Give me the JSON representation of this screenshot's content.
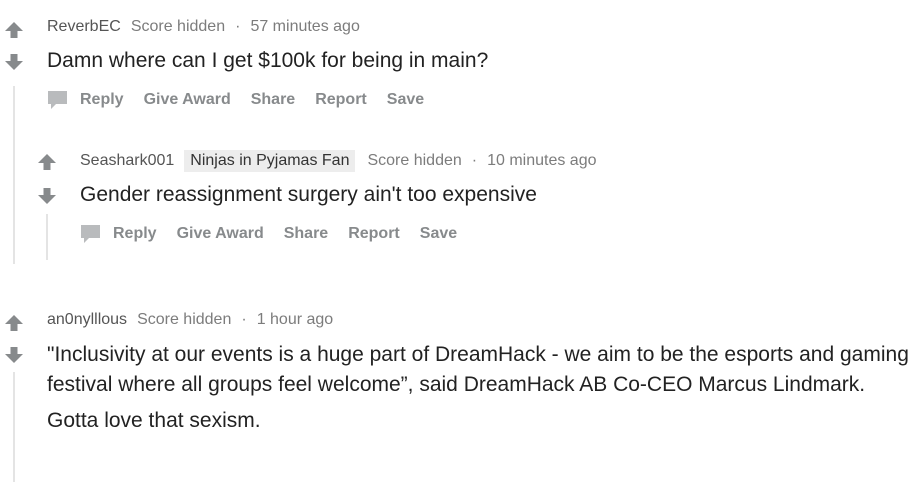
{
  "comments": [
    {
      "author": "ReverbEC",
      "score": "Score hidden",
      "time": "57 minutes ago",
      "text": [
        "Damn where can I get $100k for being in main?"
      ],
      "actions": {
        "reply": "Reply",
        "award": "Give Award",
        "share": "Share",
        "report": "Report",
        "save": "Save"
      }
    },
    {
      "author": "Seashark001",
      "flair": "Ninjas in Pyjamas Fan",
      "score": "Score hidden",
      "time": "10 minutes ago",
      "text": [
        "Gender reassignment surgery ain't too expensive"
      ],
      "actions": {
        "reply": "Reply",
        "award": "Give Award",
        "share": "Share",
        "report": "Report",
        "save": "Save"
      }
    },
    {
      "author": "an0nylllous",
      "score": "Score hidden",
      "time": "1 hour ago",
      "text": [
        "\"Inclusivity at our events is a huge part of DreamHack - we aim to be the esports and gaming festival where all groups feel welcome”, said DreamHack AB Co-CEO Marcus Lindmark.",
        "Gotta love that sexism."
      ]
    }
  ],
  "separator": "·"
}
